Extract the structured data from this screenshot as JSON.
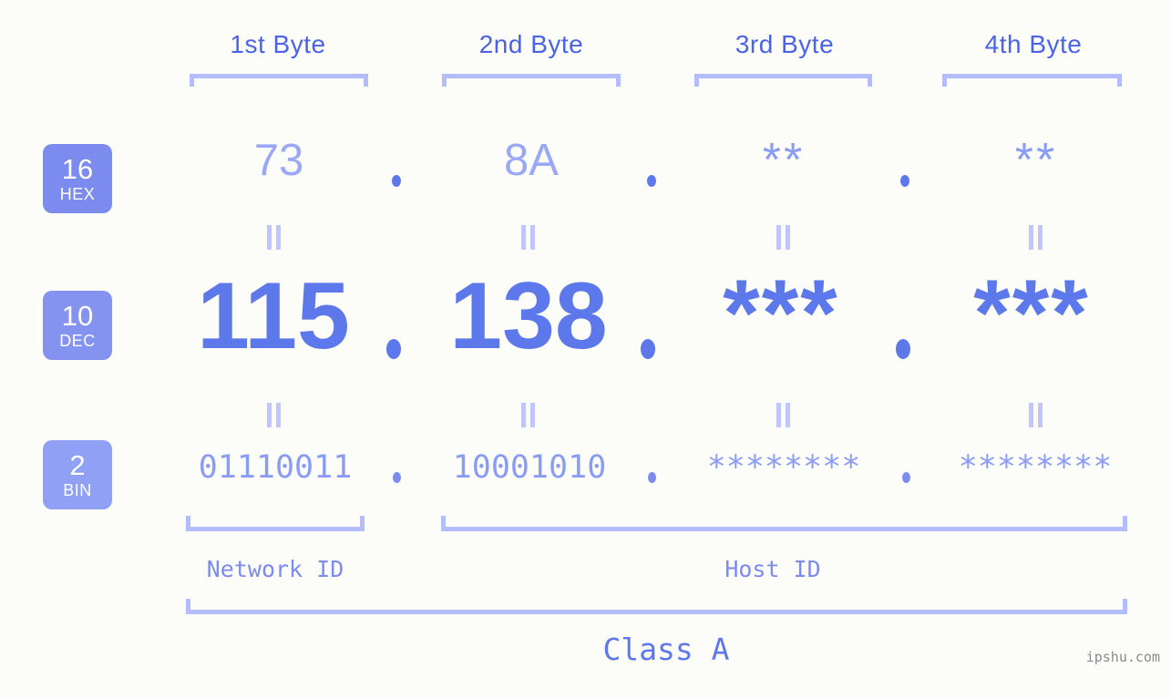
{
  "page": {
    "background_color": "#fcfdf9",
    "accent_color": "#5c78ea",
    "accent_light_color": "#b3bdfb",
    "badge_color": "#7b8bee",
    "watermark": "ipshu.com"
  },
  "byte_headers": [
    {
      "label": "1st Byte"
    },
    {
      "label": "2nd Byte"
    },
    {
      "label": "3rd Byte"
    },
    {
      "label": "4th Byte"
    }
  ],
  "bases": [
    {
      "number": "16",
      "name": "HEX"
    },
    {
      "number": "10",
      "name": "DEC"
    },
    {
      "number": "2",
      "name": "BIN"
    }
  ],
  "rows": {
    "hex": {
      "base_number": "16",
      "base_name": "HEX",
      "values": [
        "73",
        "8A",
        "**",
        "**"
      ],
      "separator": "."
    },
    "dec": {
      "base_number": "10",
      "base_name": "DEC",
      "values": [
        "115",
        "138",
        "***",
        "***"
      ],
      "separator": "."
    },
    "bin": {
      "base_number": "2",
      "base_name": "BIN",
      "values": [
        "01110011",
        "10001010",
        "********",
        "********"
      ],
      "separator": "."
    }
  },
  "equals_marks": {
    "symbol": "=",
    "count_per_row_gap": 4
  },
  "segments": {
    "network_id": "Network ID",
    "host_id": "Host ID"
  },
  "class": {
    "label": "Class A"
  }
}
